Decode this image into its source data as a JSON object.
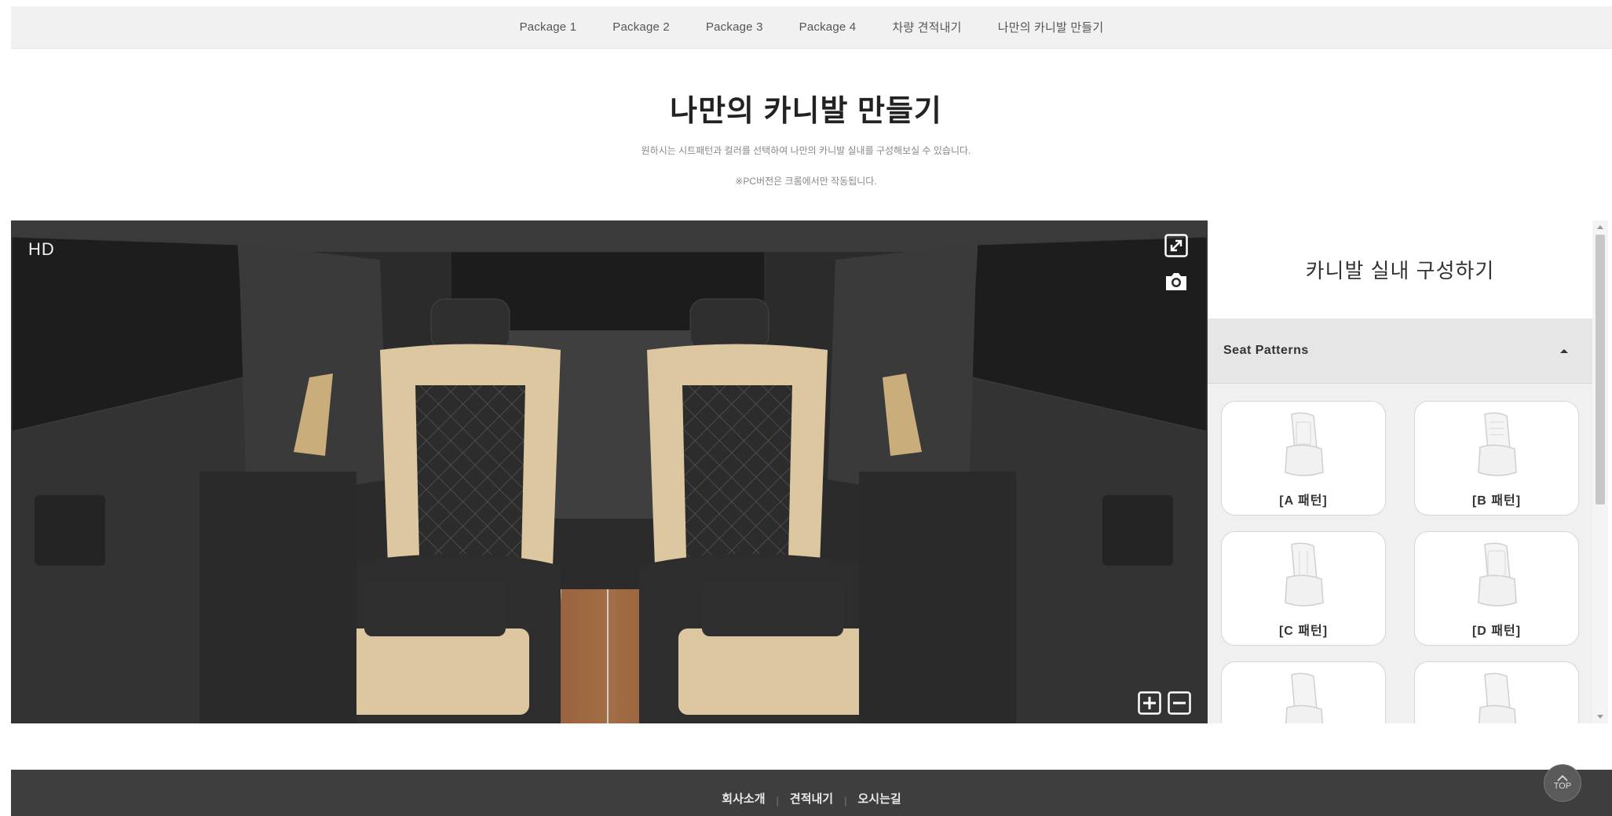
{
  "nav": {
    "items": [
      "Package 1",
      "Package 2",
      "Package 3",
      "Package 4",
      "차량 견적내기",
      "나만의 카니발 만들기"
    ]
  },
  "heading": {
    "title": "나만의 카니발 만들기",
    "description": "원하시는 시트패턴과 컬러를 선택하여 나만의 카니발 실내를 구성해보실 수 있습니다.",
    "note": "※PC버전은 크롬에서만 작동됩니다."
  },
  "viewer": {
    "quality_label": "HD",
    "colors": {
      "seat_beige": "#dcc7a1",
      "seat_dark": "#2f2f2f",
      "cabin": "#3a3a3a",
      "floor": "#8a5a3a"
    }
  },
  "panel": {
    "title": "카니발 실내 구성하기",
    "section_title": "Seat Patterns",
    "patterns": [
      {
        "label": "[A 패턴]"
      },
      {
        "label": "[B 패턴]"
      },
      {
        "label": "[C 패턴]"
      },
      {
        "label": "[D 패턴]"
      },
      {
        "label": ""
      },
      {
        "label": ""
      }
    ]
  },
  "footer": {
    "links": [
      "회사소개",
      "견적내기",
      "오시는길"
    ],
    "top_label": "TOP"
  }
}
